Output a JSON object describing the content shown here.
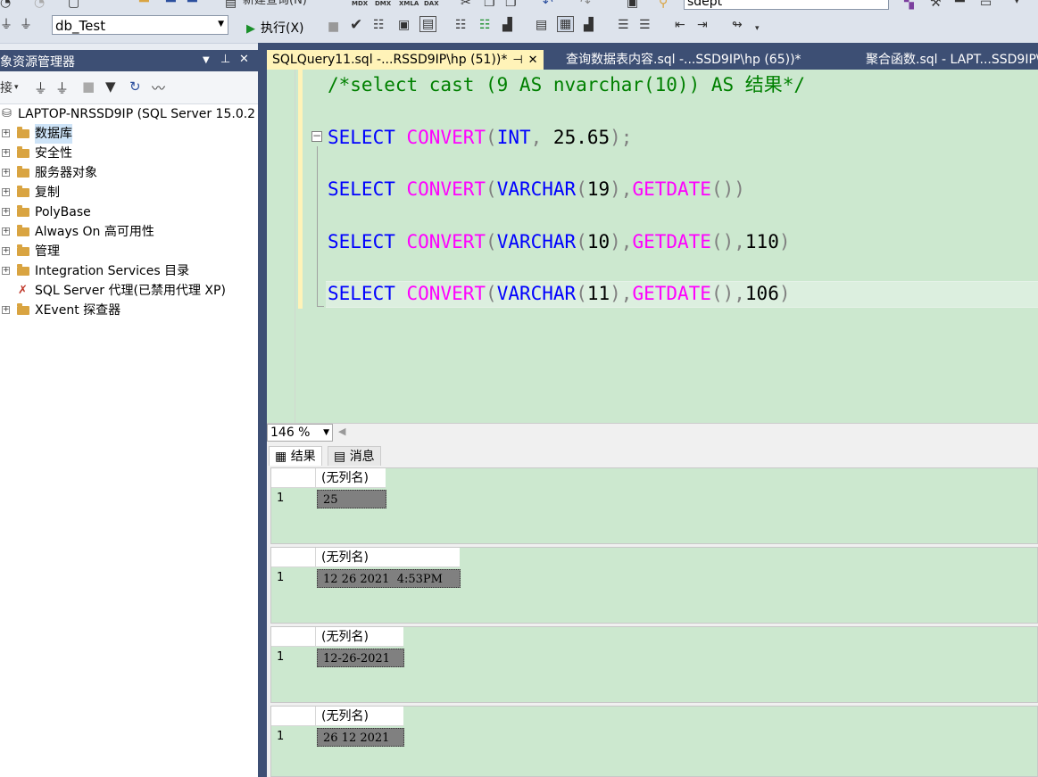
{
  "toolbar": {
    "new_query_label": "新建查询(N)",
    "mdx": "MDX",
    "dmx": "DMX",
    "xmla": "XMLA",
    "dax": "DAX",
    "search_value": "sdept",
    "database_selector": "db_Test",
    "execute_label": "执行(X)"
  },
  "object_explorer": {
    "title": "象资源管理器",
    "connect_label": "接",
    "server": "LAPTOP-NRSSD9IP (SQL Server 15.0.2",
    "nodes": [
      {
        "label": "数据库",
        "expandable": true,
        "selected": true
      },
      {
        "label": "安全性",
        "expandable": true
      },
      {
        "label": "服务器对象",
        "expandable": true
      },
      {
        "label": "复制",
        "expandable": true
      },
      {
        "label": "PolyBase",
        "expandable": true
      },
      {
        "label": "Always On 高可用性",
        "expandable": true
      },
      {
        "label": "管理",
        "expandable": true
      },
      {
        "label": "Integration Services 目录",
        "expandable": true
      },
      {
        "label": "SQL Server 代理(已禁用代理 XP)",
        "expandable": false
      },
      {
        "label": "XEvent 探查器",
        "expandable": true
      }
    ]
  },
  "tabs": [
    {
      "label": "SQLQuery11.sql -...RSSD9IP\\hp (51))*",
      "active": true
    },
    {
      "label": "查询数据表内容.sql -...SSD9IP\\hp (65))*",
      "active": false
    },
    {
      "label": "聚合函数.sql - LAPT...SSD9IP\\",
      "active": false
    }
  ],
  "editor": {
    "comment": "/*select cast (9 AS nvarchar(10)) AS 结果*/",
    "lines": [
      {
        "kw": "SELECT",
        "fn": "CONVERT",
        "type": "INT",
        "sep": ", ",
        "arg": "25.65",
        "end": ");"
      },
      {
        "kw": "SELECT",
        "fn": "CONVERT",
        "type": "VARCHAR",
        "len": "19",
        "fn2": "GETDATE"
      },
      {
        "kw": "SELECT",
        "fn": "CONVERT",
        "type": "VARCHAR",
        "len": "10",
        "fn2": "GETDATE",
        "style": "110"
      },
      {
        "kw": "SELECT",
        "fn": "CONVERT",
        "type": "VARCHAR",
        "len": "11",
        "fn2": "GETDATE",
        "style": "106"
      }
    ]
  },
  "zoom": "146 %",
  "result_tabs": {
    "results": "结果",
    "messages": "消息"
  },
  "result_grids": [
    {
      "header": "(无列名)",
      "row": "1",
      "value": "25"
    },
    {
      "header": "(无列名)",
      "row": "1",
      "value": "12 26 2021  4:53PM"
    },
    {
      "header": "(无列名)",
      "row": "1",
      "value": "12-26-2021"
    },
    {
      "header": "(无列名)",
      "row": "1",
      "value": "26 12 2021"
    }
  ],
  "colors": {
    "editor_bg": "#cce8cf",
    "keyword": "#0000ff",
    "function": "#ff00ff",
    "comment": "#008000",
    "tab_active": "#fff3b8",
    "chrome": "#3d4f74"
  }
}
